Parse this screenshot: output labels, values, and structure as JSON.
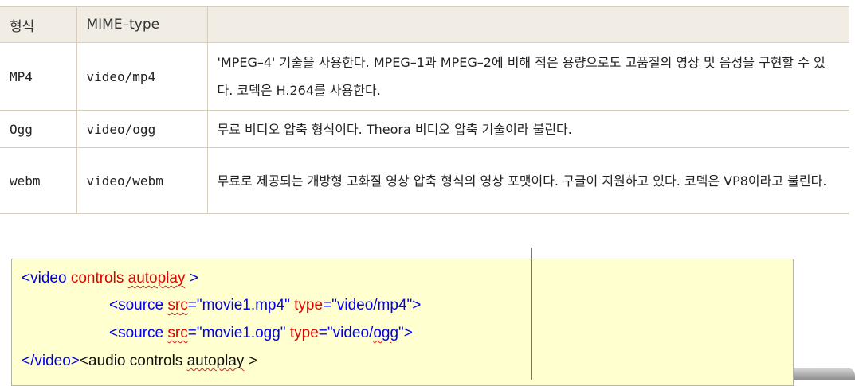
{
  "table": {
    "headers": [
      "형식",
      "MIME–type",
      ""
    ],
    "rows": [
      {
        "format": "MP4",
        "mime": "video/mp4",
        "desc": "'MPEG–4' 기술을 사용한다. MPEG–1과 MPEG–2에 비해 적은 용량으로도 고품질의 영상 및 음성을 구현할 수 있다. 코덱은 H.264를 사용한다."
      },
      {
        "format": "Ogg",
        "mime": "video/ogg",
        "desc": "무료 비디오 압축 형식이다. Theora 비디오 압축 기술이라 불린다."
      },
      {
        "format": "webm",
        "mime": "video/webm",
        "desc": "무료로 제공되는 개방형 고화질 영상 압축 형식의 영상 포맷이다. 구글이 지원하고 있다. 코덱은 VP8이라고 불린다."
      }
    ]
  },
  "code": {
    "line1": {
      "open": "<video",
      "attr1": "controls",
      "attr2": "autoplay",
      "close": " >"
    },
    "line2": {
      "tag": "<source",
      "src_attr": "src",
      "src_val": "=\"movie1.mp4\"",
      "type_attr": "type",
      "type_val": "=\"video/mp4\">"
    },
    "line3": {
      "tag": "<source",
      "src_attr": "src",
      "src_val": "=\"movie1.ogg\"",
      "type_attr": "type",
      "type_val_a": "=\"video/",
      "type_val_b": "ogg",
      "type_val_c": "\">"
    },
    "line4": {
      "end_tag": "</video>",
      "rest_a": "<audio controls ",
      "rest_b": "autoplay",
      "rest_c": " >"
    }
  }
}
